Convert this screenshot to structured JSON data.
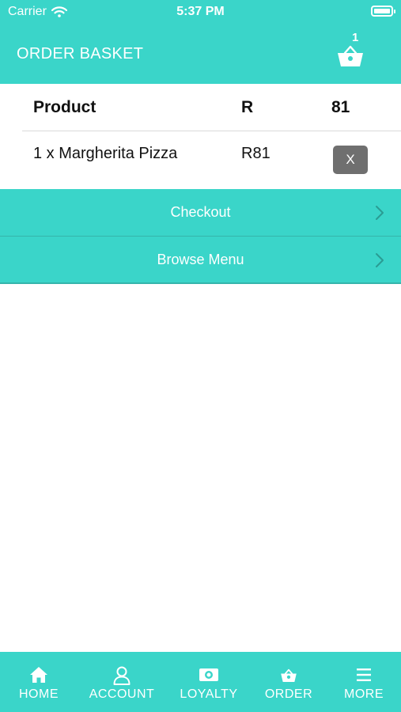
{
  "status_bar": {
    "carrier": "Carrier",
    "time": "5:37 PM"
  },
  "header": {
    "title": "ORDER BASKET",
    "basket_count": "1",
    "basket_icon": "basket-icon"
  },
  "basket_table": {
    "headers": [
      "Product",
      "R",
      "81"
    ],
    "rows": [
      {
        "product": "1 x Margherita Pizza",
        "price": "R81",
        "remove_label": "X"
      }
    ]
  },
  "actions": {
    "checkout_label": "Checkout",
    "browse_menu_label": "Browse Menu"
  },
  "tab_bar": {
    "items": [
      {
        "label": "HOME",
        "icon": "home-icon"
      },
      {
        "label": "ACCOUNT",
        "icon": "user-icon"
      },
      {
        "label": "LOYALTY",
        "icon": "loyalty-icon"
      },
      {
        "label": "ORDER",
        "icon": "basket-icon"
      },
      {
        "label": "MORE",
        "icon": "menu-icon"
      }
    ]
  },
  "colors": {
    "brand_teal": "#3ad5c9",
    "remove_button": "#6f6f6f",
    "text": "#111111"
  }
}
